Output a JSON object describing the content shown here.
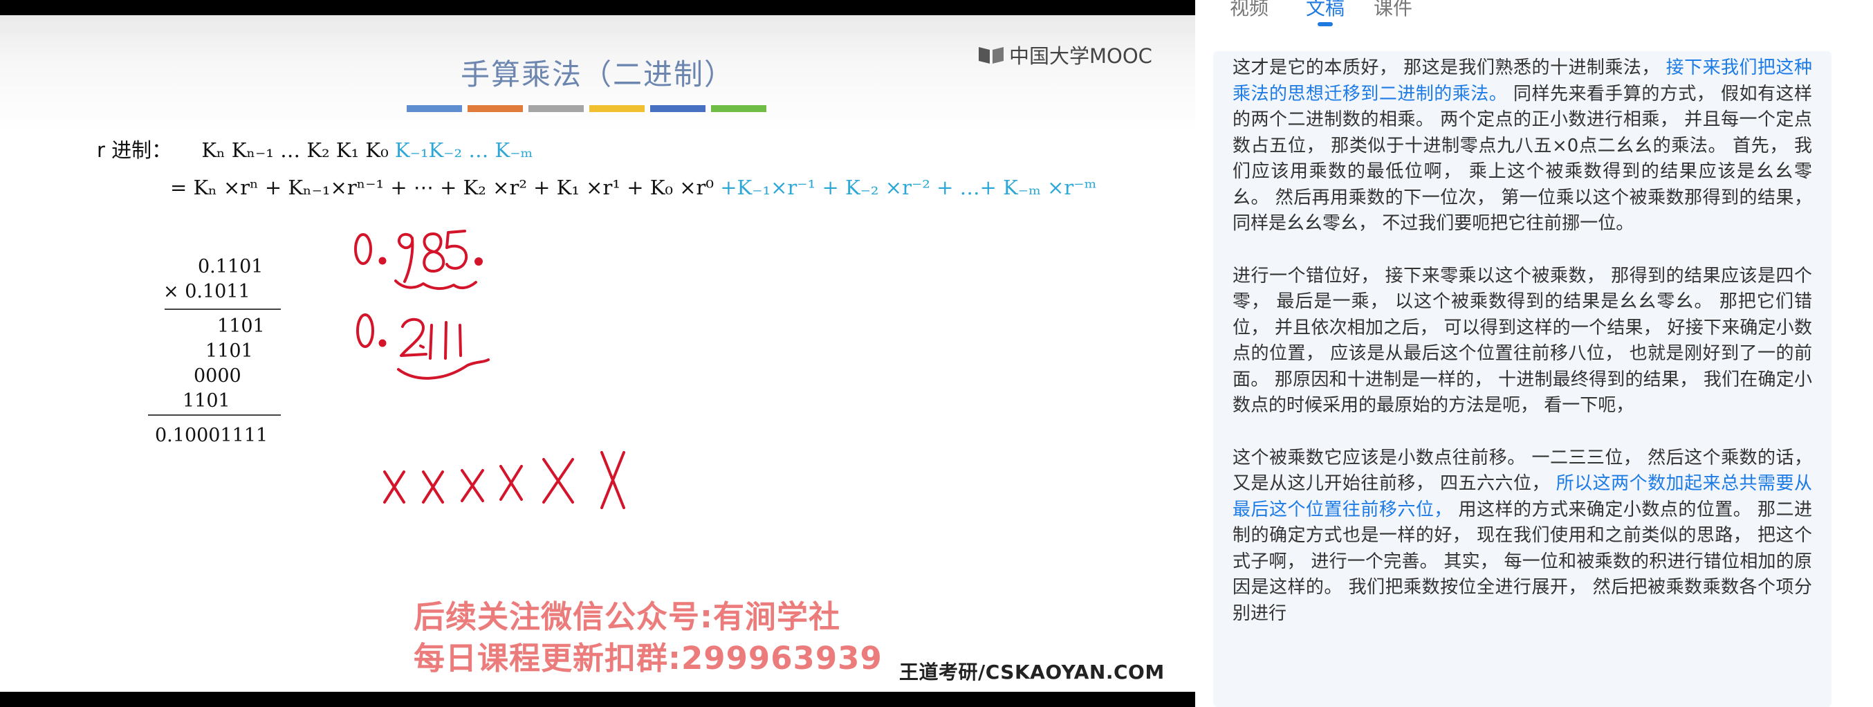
{
  "slide": {
    "title": "手算乘法（二进制）",
    "logo_text": "中国大学MOOC",
    "color_bar": [
      "#5f8ed0",
      "#e07b3c",
      "#a5a5a5",
      "#f0c030",
      "#4870c2",
      "#6fbd46"
    ],
    "formula_line1": {
      "label": "r 进制：",
      "integer_part": "Kₙ Kₙ₋₁ … K₂ K₁ K₀",
      "fraction_part": "K₋₁K₋₂ … K₋ₘ"
    },
    "formula_line2": {
      "integer_part": "= Kₙ ×rⁿ + Kₙ₋₁×rⁿ⁻¹ + ⋯ + K₂ ×r² + K₁ ×r¹ + K₀ ×r⁰",
      "fraction_part": "+K₋₁×r⁻¹ + K₋₂ ×r⁻² + …+ K₋ₘ ×r⁻ᵐ"
    },
    "multiplication": {
      "multiplicand": "0.1101",
      "multiplier": "× 0.1011",
      "partials": [
        "1101",
        "1101",
        "0000",
        "1101"
      ],
      "result": "0.10001111"
    },
    "watermark_lines": [
      "后续关注微信公众号:有涧学社",
      "每日课程更新扣群:299963939"
    ],
    "brand": "王道考研/CSKAOYAN.COM"
  },
  "panel": {
    "tabs": [
      "视频",
      "文稿",
      "课件"
    ],
    "active_tab_index": 1,
    "accent_color": "#1d7be5",
    "paragraphs": [
      [
        {
          "text": "这才是它的本质好， 那这是我们熟悉的十进制乘法， ",
          "highlight": false
        },
        {
          "text": "接下来我们把这种乘法的思想迁移到二进制的乘法。",
          "highlight": true
        },
        {
          "text": " 同样先来看手算的方式， 假如有这样的两个二进制数的相乘。 两个定点的正小数进行相乘， 并且每一个定点数占五位， 那类似于十进制零点九八五×0点二幺幺的乘法。 首先， 我们应该用乘数的最低位啊， 乘上这个被乘数得到的结果应该是幺幺零幺。 然后再用乘数的下一位次， 第一位乘以这个被乘数那得到的结果， 同样是幺幺零幺， 不过我们要呃把它往前挪一位。",
          "highlight": false
        }
      ],
      [
        {
          "text": "进行一个错位好， 接下来零乘以这个被乘数， 那得到的结果应该是四个零， 最后是一乘， 以这个被乘数得到的结果是幺幺零幺。 那把它们错位， 并且依次相加之后， 可以得到这样的一个结果， 好接下来确定小数点的位置， 应该是从最后这个位置往前移八位， 也就是刚好到了一的前面。 那原因和十进制是一样的， 十进制最终得到的结果， 我们在确定小数点的时候采用的最原始的方法是呃， 看一下呃，",
          "highlight": false
        }
      ],
      [
        {
          "text": "这个被乘数它应该是小数点往前移。 一二三三位， 然后这个乘数的话， 又是从这儿开始往前移， 四五六六位， ",
          "highlight": false
        },
        {
          "text": "所以这两个数加起来总共需要从最后这个位置往前移六位，",
          "highlight": true
        },
        {
          "text": " 用这样的方式来确定小数点的位置。 那二进制的确定方式也是一样的好， 现在我们使用和之前类似的思路， 把这个式子啊， 进行一个完善。 其实， 每一位和被乘数的积进行错位相加的原因是这样的。 我们把乘数按位全进行展开， 然后把被乘数乘数各个项分别进行",
          "highlight": false
        }
      ]
    ]
  }
}
